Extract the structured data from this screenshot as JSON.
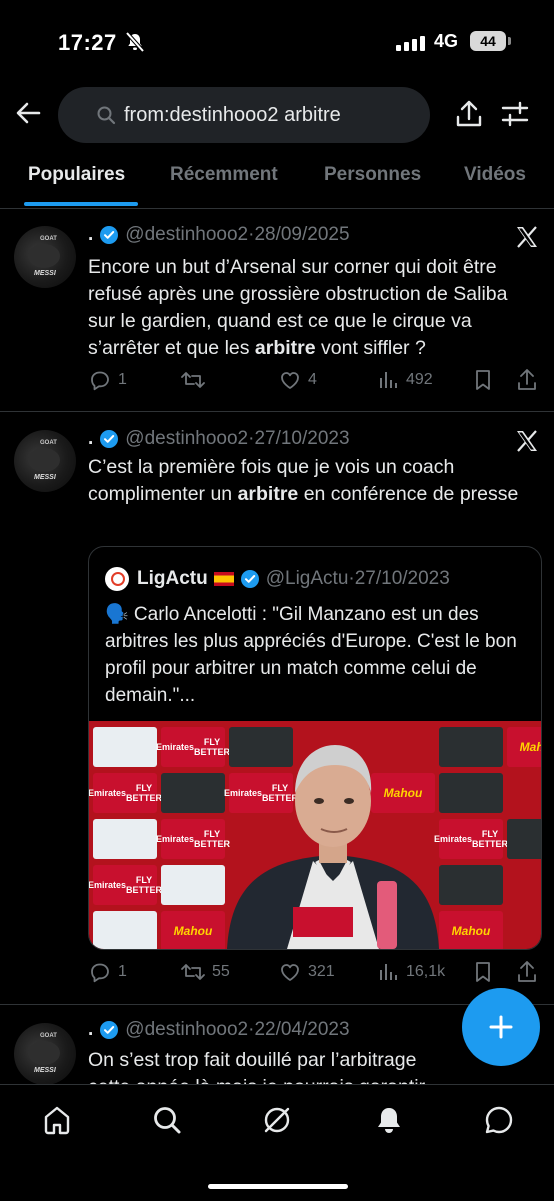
{
  "status_bar": {
    "time": "17:27",
    "network": "4G",
    "battery": "44"
  },
  "search": {
    "query": "from:destinhooo2 arbitre"
  },
  "tabs": [
    {
      "label": "Populaires",
      "active": true
    },
    {
      "label": "Récemment",
      "active": false
    },
    {
      "label": "Personnes",
      "active": false
    },
    {
      "label": "Vidéos",
      "active": false
    }
  ],
  "tweets": [
    {
      "name": ".",
      "handle": "@destinhooo2",
      "date": "28/09/2025",
      "text_before": "Encore un but d’Arsenal sur corner qui doit être refusé après une grossière obstruction de Saliba sur le gardien, quand est ce que le cirque va s’arrêter et que les ",
      "text_bold": "arbitre",
      "text_after": " vont siffler ?",
      "replies": "1",
      "retweets": "",
      "likes": "4",
      "views": "492"
    },
    {
      "name": ".",
      "handle": "@destinhooo2",
      "date": "27/10/2023",
      "text_before": "C’est la première fois que je vois un coach complimenter un ",
      "text_bold": "arbitre",
      "text_after": " en conférence de presse",
      "quote": {
        "name": "LigActu",
        "handle": "@LigActu",
        "date": "27/10/2023",
        "text": "🗣️ Carlo Ancelotti : \"Gil Manzano est un des arbitres les plus appréciés d'Europe. C'est le bon profil pour arbitrer un match comme celui de demain.\"...",
        "sponsor_emirates": "Emirates",
        "sponsor_emirates_sub": "FLY BETTER",
        "sponsor_mahou": "Mahou"
      },
      "replies": "1",
      "retweets": "55",
      "likes": "321",
      "views": "16,1k"
    },
    {
      "name": ".",
      "handle": "@destinhooo2",
      "date": "22/04/2023",
      "text": "On s’est trop fait douillé par l’arbitrage cette année là mais je pourrais garantir"
    }
  ],
  "avatar": {
    "top_text": "GOAT",
    "bottom_text": "MESSI"
  },
  "colors": {
    "accent": "#1d9bf0",
    "background": "#000000",
    "muted": "#71767b"
  }
}
